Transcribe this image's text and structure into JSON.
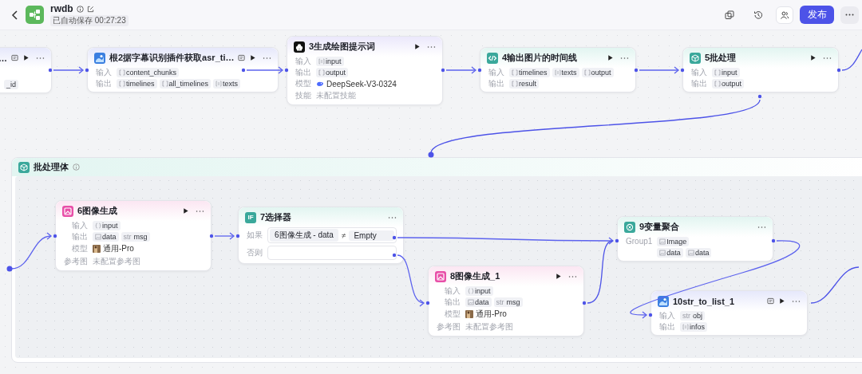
{
  "header": {
    "title": "rwdb",
    "autosave": "已自动保存 00:27:23",
    "publish": "发布"
  },
  "nodes": [
    {
      "title": "…",
      "kind": "plugin",
      "rows": [
        {
          "kind": "tags",
          "tags": [
            {
              "kind": "plain",
              "name": "_id"
            }
          ]
        }
      ]
    },
    {
      "title": "根2据字幕识别插件获取asr_ti…",
      "kind": "plugin",
      "rows": [
        {
          "kind": "tags",
          "label": "输入",
          "tags": [
            {
              "kind": "array",
              "name": "content_chunks"
            }
          ]
        },
        {
          "kind": "tags",
          "label": "输出",
          "tags": [
            {
              "kind": "array",
              "name": "timelines"
            },
            {
              "kind": "array",
              "name": "all_timelines"
            },
            {
              "kind": "list",
              "name": "texts"
            }
          ]
        }
      ]
    },
    {
      "title": "3生成绘图提示词",
      "kind": "llm",
      "rows": [
        {
          "kind": "tags",
          "label": "输入",
          "tags": [
            {
              "kind": "list",
              "name": "input"
            }
          ]
        },
        {
          "kind": "tags",
          "label": "输出",
          "tags": [
            {
              "kind": "array",
              "name": "output"
            }
          ]
        },
        {
          "kind": "model",
          "label": "模型",
          "model": "DeepSeek-V3-0324"
        },
        {
          "kind": "note",
          "label": "技能",
          "text": "未配置技能"
        }
      ]
    },
    {
      "title": "4输出图片的时间线",
      "kind": "code",
      "rows": [
        {
          "kind": "tags",
          "label": "输入",
          "tags": [
            {
              "kind": "array",
              "name": "timelines"
            },
            {
              "kind": "list",
              "name": "texts"
            },
            {
              "kind": "array",
              "name": "output"
            }
          ]
        },
        {
          "kind": "tags",
          "label": "输出",
          "tags": [
            {
              "kind": "array",
              "name": "result"
            }
          ]
        }
      ]
    },
    {
      "title": "5批处理",
      "kind": "batch",
      "rows": [
        {
          "kind": "tags",
          "label": "输入",
          "tags": [
            {
              "kind": "array",
              "name": "input"
            }
          ]
        },
        {
          "kind": "tags",
          "label": "输出",
          "tags": [
            {
              "kind": "array",
              "name": "output"
            }
          ]
        }
      ]
    }
  ],
  "batch_body": {
    "title": "批处理体",
    "nodes": [
      {
        "title": "6图像生成",
        "kind": "image",
        "rows": [
          {
            "kind": "tags",
            "label": "输入",
            "tags": [
              {
                "kind": "object",
                "name": "input"
              }
            ]
          },
          {
            "kind": "tags",
            "label": "输出",
            "tags": [
              {
                "kind": "image",
                "name": "data"
              },
              {
                "kind": "string",
                "prefix": "str",
                "name": "msg"
              }
            ]
          },
          {
            "kind": "model",
            "label": "模型",
            "model": "通用-Pro"
          },
          {
            "kind": "note",
            "label": "参考图",
            "text": "未配置参考图"
          }
        ]
      },
      {
        "title": "7选择器",
        "kind": "selector",
        "icon_text": "IF",
        "rows": [
          {
            "kind": "condition",
            "label": "如果",
            "left": "6图像生成 - data",
            "op": "≠",
            "right": "Empty"
          },
          {
            "kind": "else",
            "label": "否则"
          }
        ]
      },
      {
        "title": "9变量聚合",
        "kind": "aggregate",
        "rows": [
          {
            "kind": "tags",
            "label": "Group1",
            "tags": [
              {
                "kind": "image",
                "name": "Image"
              }
            ]
          },
          {
            "kind": "tags",
            "tags": [
              {
                "kind": "image",
                "name": "data"
              },
              {
                "kind": "image",
                "name": "data"
              }
            ]
          }
        ]
      },
      {
        "title": "8图像生成_1",
        "kind": "image",
        "rows": [
          {
            "kind": "tags",
            "label": "输入",
            "tags": [
              {
                "kind": "object",
                "name": "input"
              }
            ]
          },
          {
            "kind": "tags",
            "label": "输出",
            "tags": [
              {
                "kind": "image",
                "name": "data"
              },
              {
                "kind": "string",
                "prefix": "str",
                "name": "msg"
              }
            ]
          },
          {
            "kind": "model",
            "label": "模型",
            "model": "通用-Pro"
          },
          {
            "kind": "note",
            "label": "参考图",
            "text": "未配置参考图"
          }
        ]
      },
      {
        "title": "10str_to_list_1",
        "kind": "plugin",
        "rows": [
          {
            "kind": "tags",
            "label": "输入",
            "tags": [
              {
                "kind": "string",
                "prefix": "str",
                "name": "obj"
              }
            ]
          },
          {
            "kind": "tags",
            "label": "输出",
            "tags": [
              {
                "kind": "list",
                "name": "infos"
              }
            ]
          }
        ]
      }
    ]
  }
}
